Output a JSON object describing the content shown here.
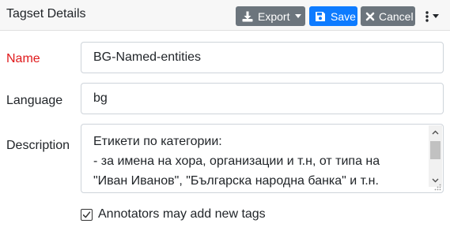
{
  "header": {
    "title": "Tagset Details",
    "export_label": "Export",
    "save_label": "Save",
    "cancel_label": "Cancel"
  },
  "form": {
    "name_label": "Name",
    "name_value": "BG-Named-entities",
    "language_label": "Language",
    "language_value": "bg",
    "description_label": "Description",
    "description_value": "Етикети по категории:\n- за имена на хора, организации и т.н, от типа на\n\"Иван Иванов\", \"Българска народна банка\" и т.н.",
    "checkbox_label": "Annotators may add new tags",
    "checkbox_checked": true
  },
  "colors": {
    "secondary": "#6c757d",
    "primary": "#0d7bff",
    "required_label": "#e0191b"
  },
  "icons": {
    "export": "download-icon",
    "save": "floppy-disk-icon",
    "cancel": "x-icon",
    "more": "vertical-dots-icon"
  }
}
